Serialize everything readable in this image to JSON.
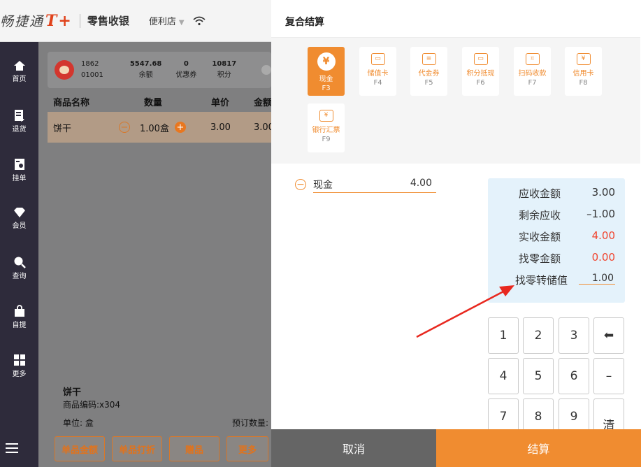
{
  "topbar": {
    "logo_text": "畅捷通",
    "logo_brand": "T+",
    "app_title": "零售收银",
    "store": "便利店"
  },
  "sidebar": {
    "items": [
      {
        "label": "首页",
        "icon": "home-icon"
      },
      {
        "label": "退货",
        "icon": "return-icon"
      },
      {
        "label": "挂单",
        "icon": "hold-order-icon"
      },
      {
        "label": "会员",
        "icon": "member-diamond-icon"
      },
      {
        "label": "查询",
        "icon": "search-icon"
      },
      {
        "label": "自提",
        "icon": "bag-icon"
      },
      {
        "label": "更多",
        "icon": "grid-icon"
      }
    ]
  },
  "member": {
    "id_top": "1862",
    "id_bottom": "01001",
    "balance_value": "5547.68",
    "balance_label": "余额",
    "coupon_value": "0",
    "coupon_label": "优惠券",
    "points_value": "10817",
    "points_label": "积分"
  },
  "table": {
    "headers": [
      "商品名称",
      "数量",
      "单价",
      "金额"
    ],
    "rows": [
      {
        "name": "饼干",
        "qty": "1.00盒",
        "price": "3.00",
        "amount": "3.00"
      }
    ]
  },
  "detail": {
    "name": "饼干",
    "code": "商品编码:x304",
    "unit": "单位: 盒",
    "order_qty": "预订数量:"
  },
  "bottom_buttons": [
    "单品金额",
    "单品打折",
    "赠品",
    "更多"
  ],
  "modal": {
    "title": "复合结算",
    "methods": [
      {
        "label": "现金",
        "key": "F3",
        "glyph": "¥",
        "active": true
      },
      {
        "label": "储值卡",
        "key": "F4",
        "glyph": "▭"
      },
      {
        "label": "代金券",
        "key": "F5",
        "glyph": "≡"
      },
      {
        "label": "积分抵现",
        "key": "F6",
        "glyph": "▭"
      },
      {
        "label": "扫码收款",
        "key": "F7",
        "glyph": "⌗"
      },
      {
        "label": "信用卡",
        "key": "F8",
        "glyph": "¥"
      },
      {
        "label": "银行汇票",
        "key": "F9",
        "glyph": "¥"
      }
    ],
    "payment_line": {
      "method": "现金",
      "amount": "4.00"
    },
    "summary": [
      {
        "label": "应收金额",
        "value": "3.00"
      },
      {
        "label": "剩余应收",
        "value": "–1.00"
      },
      {
        "label": "实收金额",
        "value": "4.00",
        "highlight": true
      },
      {
        "label": "找零金额",
        "value": "0.00",
        "highlight": true
      },
      {
        "label": "找零转储值",
        "value": "1.00",
        "input": true
      }
    ],
    "keypad": [
      "1",
      "2",
      "3",
      "⬅",
      "4",
      "5",
      "6",
      "–",
      "7",
      "8",
      "9",
      "清"
    ],
    "cancel_label": "取消",
    "pay_label": "结算"
  },
  "colors": {
    "accent": "#f08c30",
    "sidebar_bg": "#2e2b3b",
    "highlight_red": "#f0442e",
    "summary_bg": "#e4f2fb",
    "arrow": "#e8281f"
  }
}
